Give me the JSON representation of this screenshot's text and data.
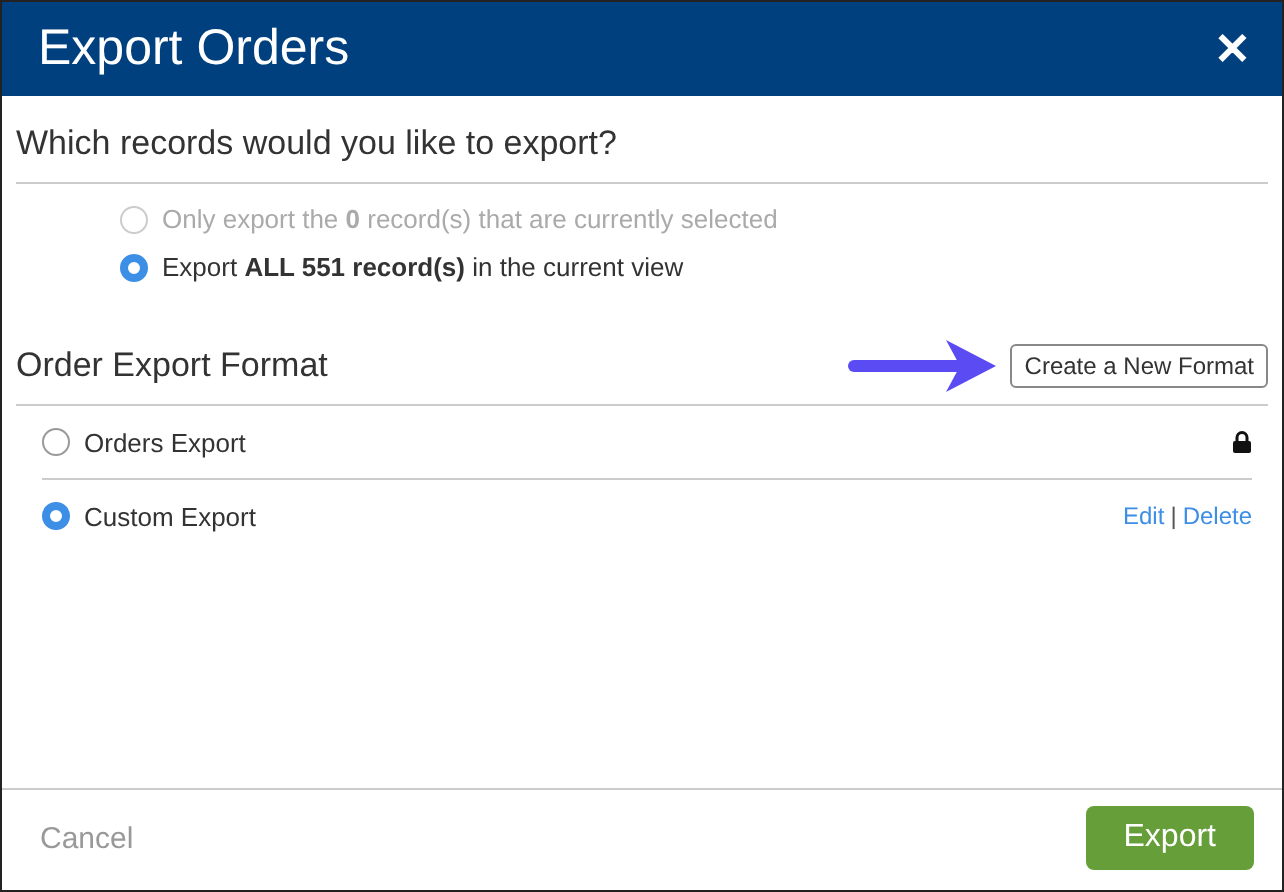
{
  "window": {
    "title": "Export Orders",
    "close": "✕"
  },
  "records": {
    "heading": "Which records would you like to export?",
    "options": [
      {
        "label": "Only export the **0** record(s) that are currently selected",
        "selected": false,
        "disabled": true
      },
      {
        "label": "Export **ALL 551 record(s)** in the current view",
        "selected": true,
        "disabled": false
      }
    ]
  },
  "format": {
    "heading": "Order Export Format",
    "new_button": "Create a New Format",
    "items": [
      {
        "label": "Orders Export",
        "selected": false,
        "locked": true
      },
      {
        "label": "Custom Export",
        "selected": true,
        "locked": false,
        "actions": [
          "Edit",
          "Delete"
        ],
        "separator": "|"
      }
    ]
  },
  "footer": {
    "cancel": "Cancel",
    "submit": "Export"
  }
}
